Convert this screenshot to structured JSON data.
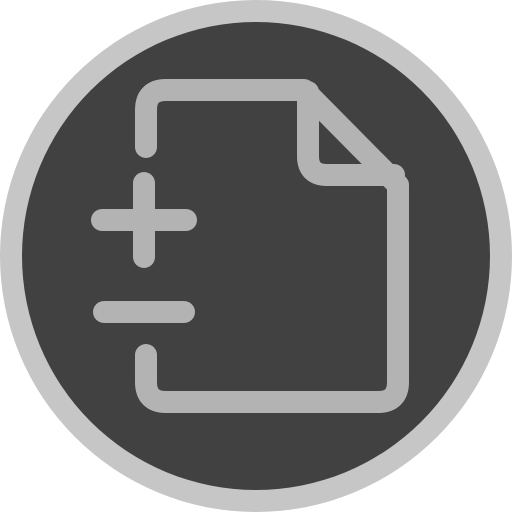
{
  "icon": {
    "name": "file-diff-icon",
    "description_shape": "document outline with plus and minus signs",
    "colors": {
      "outer_ring": "#c6c6c6",
      "inner_circle": "#414141",
      "glyph_stroke": "#b3b3b3",
      "page_background": "#ffffff"
    }
  }
}
